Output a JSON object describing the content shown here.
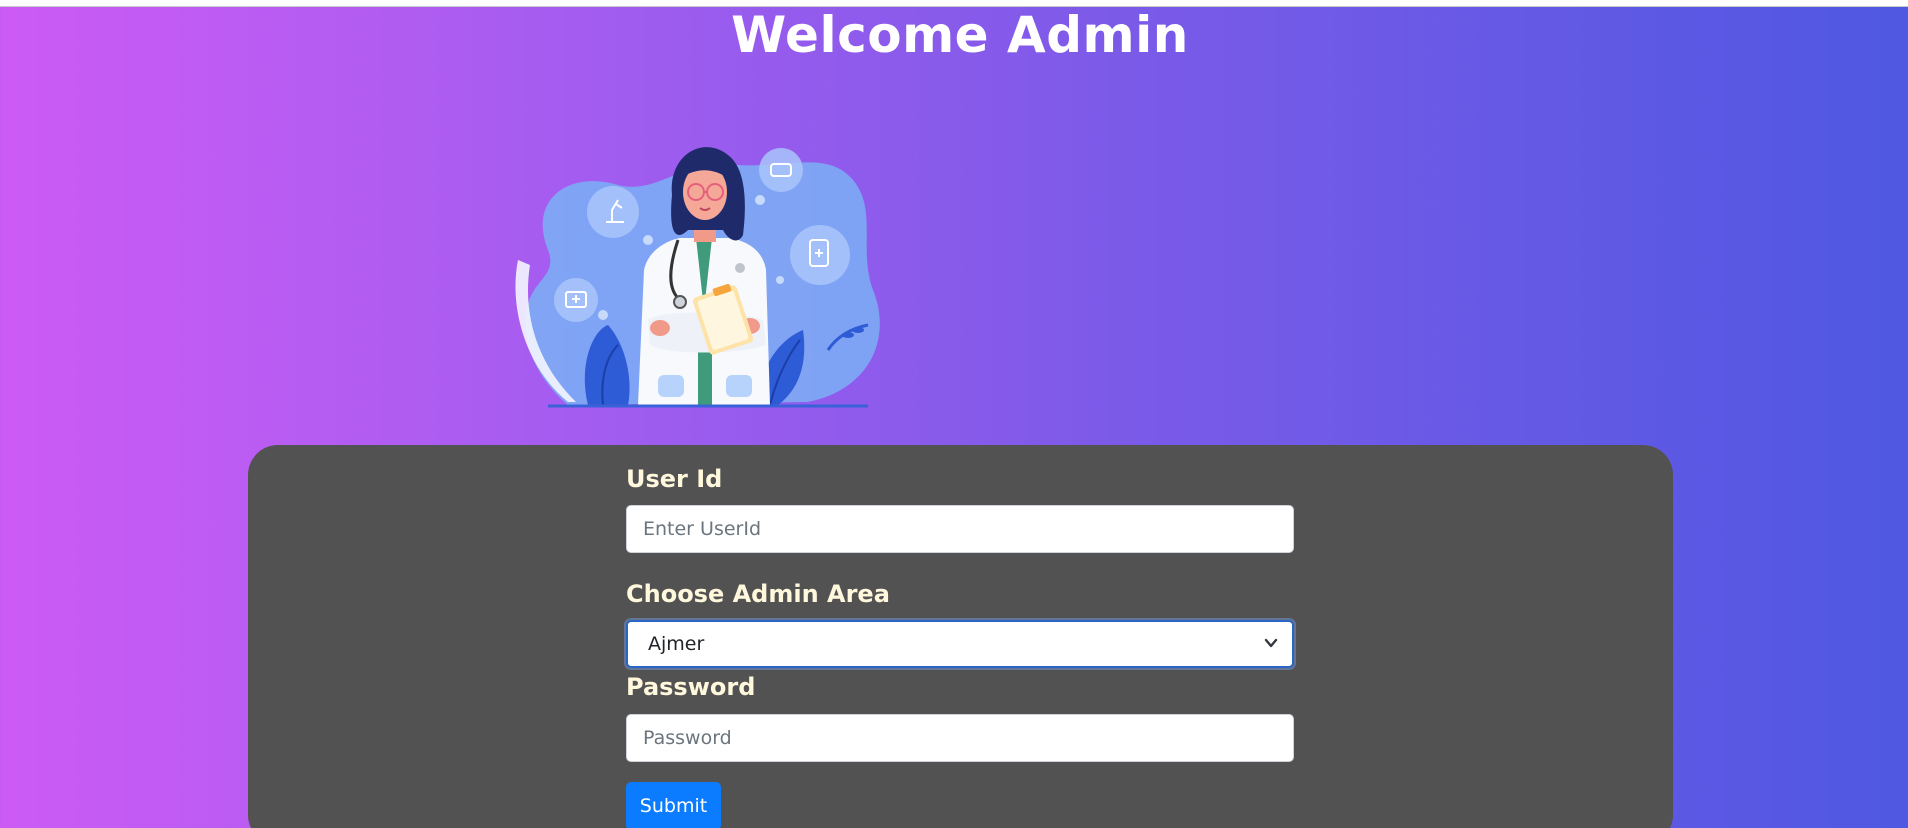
{
  "header": {
    "title": "Welcome Admin"
  },
  "hero": {
    "illustration": "doctor-with-clipboard-illustration"
  },
  "form": {
    "userid": {
      "label": "User Id",
      "placeholder": "Enter UserId",
      "value": ""
    },
    "area": {
      "label": "Choose Admin Area",
      "selected": "Ajmer"
    },
    "password": {
      "label": "Password",
      "placeholder": "Password",
      "value": ""
    },
    "submit_label": "Submit"
  },
  "colors": {
    "gradient_start": "#cc5bf4",
    "gradient_end": "#4f58e2",
    "card": "#535252",
    "label": "#fff8dc",
    "submit": "#0b7cff",
    "select_border": "#2a64c4"
  }
}
